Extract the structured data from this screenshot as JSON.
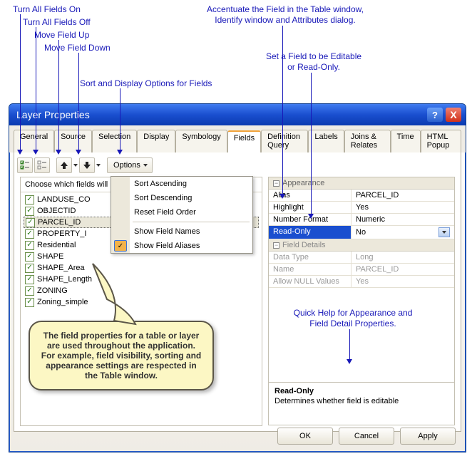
{
  "annotations": {
    "all_on": "Turn All Fields On",
    "all_off": "Turn All Fields Off",
    "move_up": "Move Field Up",
    "move_down": "Move Field Down",
    "sort_opts": "Sort and Display Options for Fields",
    "accentuate": "Accentuate the Field in the Table window,\nIdentify window and Attributes dialog.",
    "set_editable": "Set a Field to be Editable\nor Read-Only.",
    "quick_help": "Quick Help for Appearance and\nField Detail Properties."
  },
  "dialog": {
    "title": "Layer Properties",
    "help": "?",
    "close": "X"
  },
  "tabs": [
    "General",
    "Source",
    "Selection",
    "Display",
    "Symbology",
    "Fields",
    "Definition Query",
    "Labels",
    "Joins & Relates",
    "Time",
    "HTML Popup"
  ],
  "active_tab": "Fields",
  "toolbar": {
    "options_label": "Options"
  },
  "options_menu": {
    "sort_asc": "Sort Ascending",
    "sort_desc": "Sort Descending",
    "reset": "Reset Field Order",
    "show_names": "Show Field Names",
    "show_aliases": "Show Field Aliases"
  },
  "left": {
    "header": "Choose which fields will",
    "fields": [
      "LANDUSE_CO",
      "OBJECTID",
      "PARCEL_ID",
      "PROPERTY_I",
      "Residential",
      "SHAPE",
      "SHAPE_Area",
      "SHAPE_Length",
      "ZONING",
      "Zoning_simple"
    ],
    "selected_index": 2
  },
  "right": {
    "appearance_label": "Appearance",
    "alias_k": "Alias",
    "alias_v": "PARCEL_ID",
    "hl_k": "Highlight",
    "hl_v": "Yes",
    "nf_k": "Number Format",
    "nf_v": "Numeric",
    "ro_k": "Read-Only",
    "ro_v": "No",
    "details_label": "Field Details",
    "dt_k": "Data Type",
    "dt_v": "Long",
    "name_k": "Name",
    "name_v": "PARCEL_ID",
    "null_k": "Allow NULL Values",
    "null_v": "Yes",
    "help_title": "Read-Only",
    "help_body": "Determines whether field is editable"
  },
  "buttons": {
    "ok": "OK",
    "cancel": "Cancel",
    "apply": "Apply"
  },
  "callout": "The field properties for a table or layer are used throughout the application.  For example, field visibility, sorting and appearance settings are respected in the Table window."
}
